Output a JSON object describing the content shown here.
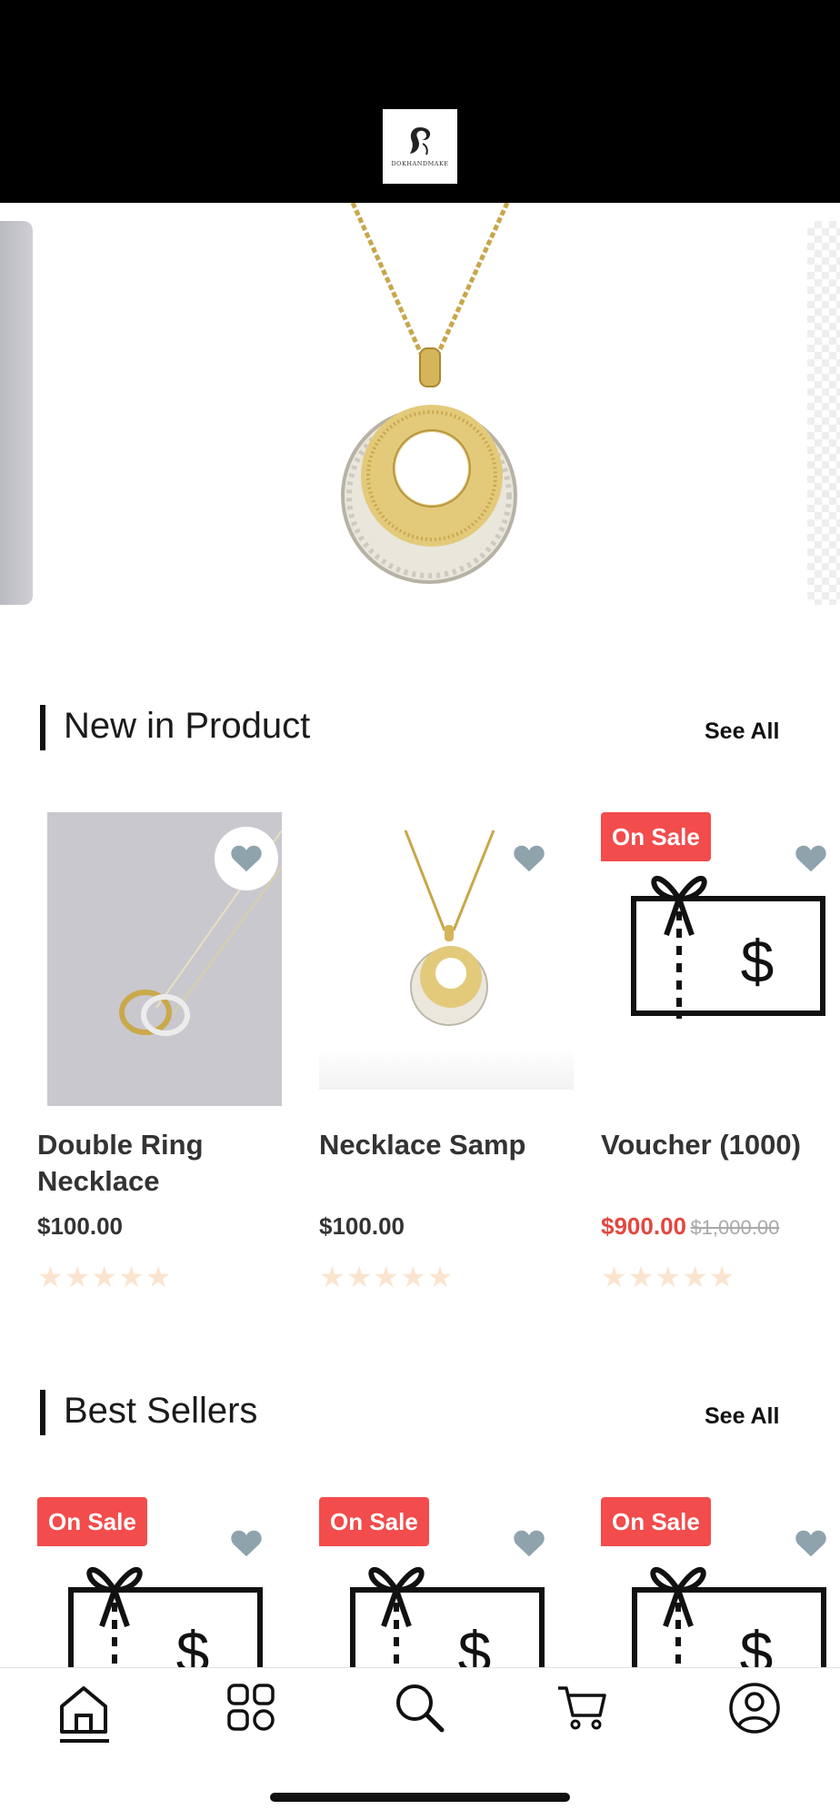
{
  "header": {
    "logo_text": "DOKHANDMAKE"
  },
  "sections": [
    {
      "title": "New in Product",
      "see_all": "See All",
      "products": [
        {
          "name_line1": "Double Ring",
          "name_line2": "Necklace",
          "price": "$100.00",
          "stars": "★★★★★",
          "badge": ""
        },
        {
          "name_line1": "Necklace Samp",
          "name_line2": "",
          "price": "$100.00",
          "stars": "★★★★★",
          "badge": ""
        },
        {
          "name_line1": "Voucher (1000)",
          "name_line2": "",
          "sale_price": "$900.00",
          "original_price": "$1,000.00",
          "stars": "★★★★★",
          "badge": "On Sale"
        }
      ]
    },
    {
      "title": "Best Sellers",
      "see_all": "See All",
      "products": [
        {
          "badge": "On Sale"
        },
        {
          "badge": "On Sale"
        },
        {
          "badge": "On Sale"
        }
      ]
    }
  ],
  "tabbar": {
    "icons": [
      "home-icon",
      "categories-icon",
      "search-icon",
      "cart-icon",
      "profile-icon"
    ]
  },
  "colors": {
    "sale": "#e2473f",
    "badge": "#f24c4c",
    "heart": "#8fa3ad",
    "stars": "#fbe4cf"
  }
}
